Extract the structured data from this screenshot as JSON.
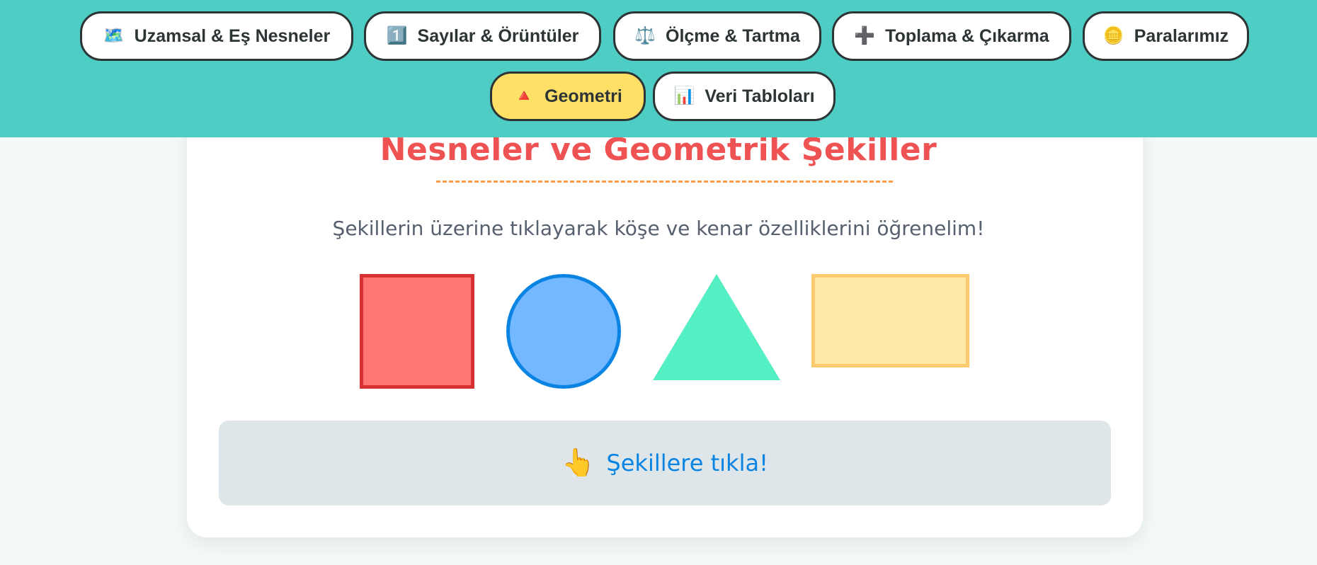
{
  "nav": {
    "items": [
      {
        "icon": "🗺️",
        "label": "Uzamsal & Eş Nesneler"
      },
      {
        "icon": "1️⃣",
        "label": "Sayılar & Örüntüler"
      },
      {
        "icon": "⚖️",
        "label": "Ölçme & Tartma"
      },
      {
        "icon": "➕",
        "label": "Toplama & Çıkarma"
      },
      {
        "icon": "🪙",
        "label": "Paralarımız"
      },
      {
        "icon": "🔺",
        "label": "Geometri",
        "active": true
      },
      {
        "icon": "📊",
        "label": "Veri Tabloları"
      }
    ]
  },
  "main": {
    "title": "Nesneler ve Geometrik Şekiller",
    "subtitle": "Şekillerin üzerine tıklayarak köşe ve kenar özelliklerini öğrenelim!",
    "shapes": [
      "square",
      "circle",
      "triangle",
      "rectangle"
    ],
    "feedback": {
      "icon": "👆",
      "text": "Şekillere tıkla!"
    }
  },
  "colors": {
    "header_bg": "#4ecdc4",
    "active_tab": "#ffe066",
    "title": "#ee5253",
    "square_fill": "#ff7675",
    "square_border": "#d63031",
    "circle_fill": "#74b9ff",
    "circle_border": "#0984e3",
    "triangle_fill": "#55efc4",
    "rectangle_fill": "#ffeaa7",
    "rectangle_border": "#fdcb6e"
  }
}
